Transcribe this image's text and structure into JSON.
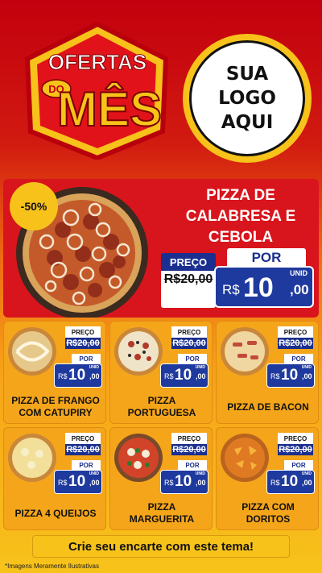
{
  "header": {
    "badge": {
      "line1": "OFERTAS",
      "line2": "DO",
      "line3": "MÊS"
    },
    "logo": {
      "line1": "SUA",
      "line2": "LOGO",
      "line3": "AQUI"
    }
  },
  "hero": {
    "discount": "-50%",
    "title": "PIZZA DE\nCALABRESA E\nCEBOLA",
    "preco_label": "PREÇO",
    "old_price": "R$20,00",
    "por_label": "POR",
    "unid_label": "UNID",
    "currency": "R$",
    "price_int": "10",
    "price_cents": ",00"
  },
  "cards": [
    {
      "name": "PIZZA DE FRANGO\nCOM CATUPIRY",
      "preco_label": "PREÇO",
      "old_price": "R$20,00",
      "por_label": "POR",
      "unid_label": "UNID",
      "currency": "R$",
      "price_int": "10",
      "price_cents": ",00"
    },
    {
      "name": "PIZZA\nPORTUGUESA",
      "preco_label": "PREÇO",
      "old_price": "R$20,00",
      "por_label": "POR",
      "unid_label": "UNID",
      "currency": "R$",
      "price_int": "10",
      "price_cents": ",00"
    },
    {
      "name": "PIZZA DE BACON",
      "preco_label": "PREÇO",
      "old_price": "R$20,00",
      "por_label": "POR",
      "unid_label": "UNID",
      "currency": "R$",
      "price_int": "10",
      "price_cents": ",00"
    },
    {
      "name": "PIZZA 4 QUEIJOS",
      "preco_label": "PREÇO",
      "old_price": "R$20,00",
      "por_label": "POR",
      "unid_label": "UNID",
      "currency": "R$",
      "price_int": "10",
      "price_cents": ",00"
    },
    {
      "name": "PIZZA\nMARGUERITA",
      "preco_label": "PREÇO",
      "old_price": "R$20,00",
      "por_label": "POR",
      "unid_label": "UNID",
      "currency": "R$",
      "price_int": "10",
      "price_cents": ",00"
    },
    {
      "name": "PIZZA COM\nDORITOS",
      "preco_label": "PREÇO",
      "old_price": "R$20,00",
      "por_label": "POR",
      "unid_label": "UNID",
      "currency": "R$",
      "price_int": "10",
      "price_cents": ",00"
    }
  ],
  "banner": "Crie seu encarte com este tema!",
  "footer": "*Imagens Meramente Ilustrativas",
  "colors": {
    "red": "#d8141c",
    "blue": "#1f3a9e",
    "yellow": "#f7c21a",
    "orange": "#f5a51a"
  }
}
